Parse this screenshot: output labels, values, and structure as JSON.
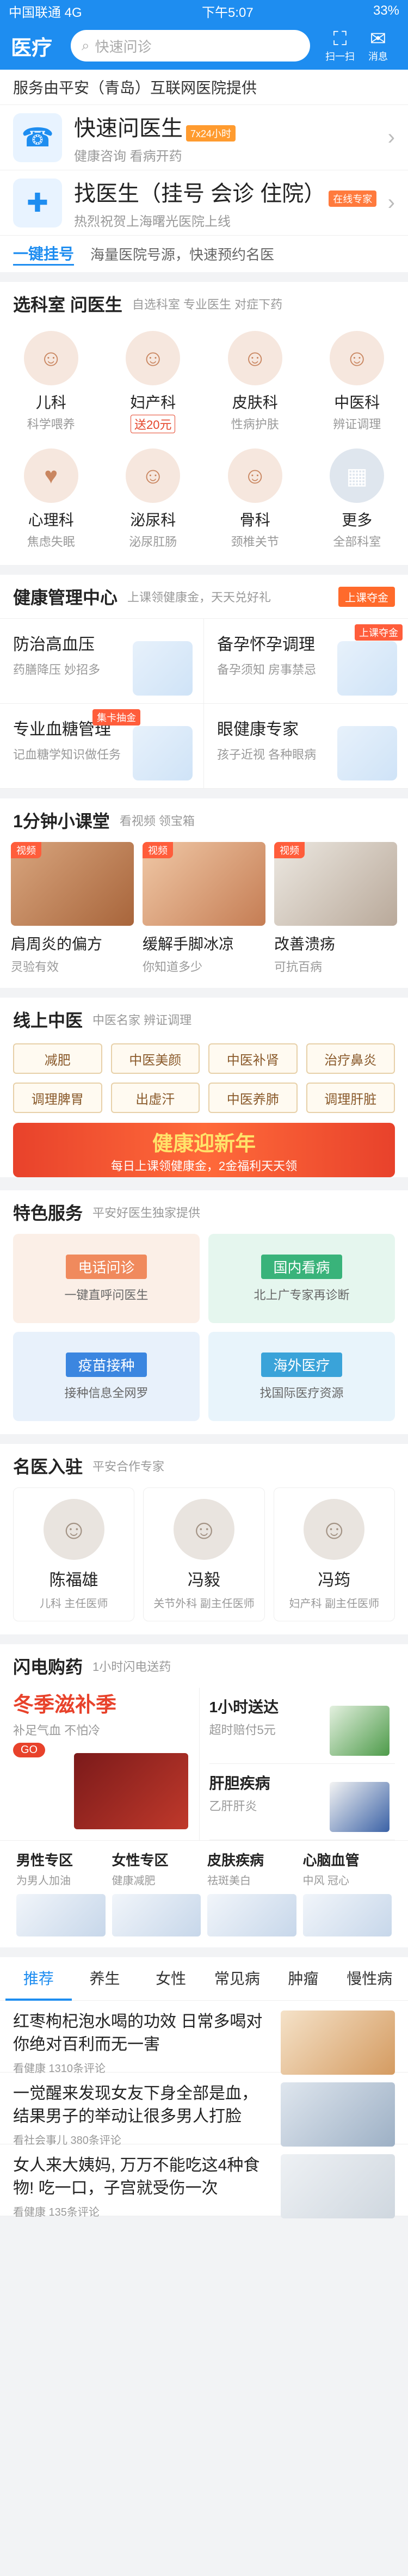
{
  "status": {
    "carrier": "中国联通 4G",
    "time": "下午5:07",
    "battery": "33%"
  },
  "top": {
    "brand": "医疗",
    "search_placeholder": "快速问诊",
    "scan": "扫一扫",
    "msg": "消息"
  },
  "provided": "服务由平安（青岛）互联网医院提供",
  "services": [
    {
      "title": "快速问医生",
      "tag": "7x24小时",
      "sub": "健康咨询 看病开药"
    },
    {
      "title": "找医生（挂号 会诊 住院）",
      "tag": "在线专家",
      "sub": "热烈祝贺上海曙光医院上线"
    }
  ],
  "quickreg": {
    "k": "一键挂号",
    "v": "海量医院号源，快速预约名医"
  },
  "depts": {
    "title": "选科室 问医生",
    "sub": "自选科室 专业医生 对症下药",
    "items": [
      {
        "nm": "儿科",
        "ds": "科学喂养"
      },
      {
        "nm": "妇产科",
        "ds": "送20元"
      },
      {
        "nm": "皮肤科",
        "ds": "性病护肤"
      },
      {
        "nm": "中医科",
        "ds": "辨证调理"
      },
      {
        "nm": "心理科",
        "ds": "焦虑失眠"
      },
      {
        "nm": "泌尿科",
        "ds": "泌尿肛肠"
      },
      {
        "nm": "骨科",
        "ds": "颈椎关节"
      },
      {
        "nm": "更多",
        "ds": "全部科室"
      }
    ]
  },
  "health": {
    "title": "健康管理中心",
    "sub": "上课领健康金，天天兑好礼",
    "badge": "上课夺金",
    "items": [
      {
        "t": "防治高血压",
        "s": "药膳降压 妙招多",
        "tag": ""
      },
      {
        "t": "备孕怀孕调理",
        "s": "备孕须知 房事禁忌",
        "tag": "上课夺金"
      },
      {
        "t": "专业血糖管理",
        "s": "记血糖学知识做任务",
        "tag": "集卡抽金"
      },
      {
        "t": "眼健康专家",
        "s": "孩子近视 各种眼病",
        "tag": ""
      }
    ]
  },
  "lessons": {
    "title": "1分钟小课堂",
    "sub": "看视频 领宝箱",
    "lbl": "视频",
    "items": [
      {
        "t": "肩周炎的偏方",
        "s": "灵验有效"
      },
      {
        "t": "缓解手脚冰凉",
        "s": "你知道多少"
      },
      {
        "t": "改善溃疡",
        "s": "可抗百病"
      }
    ]
  },
  "tcm": {
    "title": "线上中医",
    "sub": "中医名家 辨证调理",
    "items": [
      "减肥",
      "中医美颜",
      "中医补肾",
      "治疗鼻炎",
      "调理脾胃",
      "出虚汗",
      "中医养肺",
      "调理肝脏"
    ],
    "banner_a": "健康迎新年",
    "banner_b": "每日上课领健康金，2金福利天天领"
  },
  "feature": {
    "title": "特色服务",
    "sub": "平安好医生独家提供",
    "items": [
      {
        "t": "电话问诊",
        "s": "一键直呼问医生"
      },
      {
        "t": "国内看病",
        "s": "北上广专家再诊断"
      },
      {
        "t": "疫苗接种",
        "s": "接种信息全网罗"
      },
      {
        "t": "海外医疗",
        "s": "找国际医疗资源"
      }
    ]
  },
  "docs": {
    "title": "名医入驻",
    "sub": "平安合作专家",
    "items": [
      {
        "nm": "陈福雄",
        "ds": "儿科 主任医师"
      },
      {
        "nm": "冯毅",
        "ds": "关节外科 副主任医师"
      },
      {
        "nm": "冯筠",
        "ds": "妇产科 副主任医师"
      }
    ]
  },
  "shop": {
    "title": "闪电购药",
    "sub": "1小时闪电送药",
    "left_a": "冬季滋补季",
    "left_b": "补足气血 不怕冷",
    "go": "GO",
    "right": [
      {
        "t": "1小时送达",
        "s": "超时赔付5元"
      },
      {
        "t": "肝胆疾病",
        "s": "乙肝肝炎"
      }
    ],
    "four": [
      {
        "t": "男性专区",
        "s": "为男人加油"
      },
      {
        "t": "女性专区",
        "s": "健康减肥"
      },
      {
        "t": "皮肤疾病",
        "s": "祛斑美白"
      },
      {
        "t": "心脑血管",
        "s": "中风 冠心"
      }
    ]
  },
  "feed": {
    "tabs": [
      "推荐",
      "养生",
      "女性",
      "常见病",
      "肿瘤",
      "慢性病"
    ],
    "articles": [
      {
        "t": "红枣枸杞泡水喝的功效 日常多喝对你绝对百利而无一害",
        "s": "看健康 1310条评论"
      },
      {
        "t": "一觉醒来发现女友下身全部是血，结果男子的举动让很多男人打脸",
        "s": "看社会事儿 380条评论"
      },
      {
        "t": "女人来大姨妈, 万万不能吃这4种食物! 吃一口，子宫就受伤一次",
        "s": "看健康 135条评论"
      }
    ]
  },
  "icons": {
    "scan": "scan-icon",
    "msg": "message-icon",
    "search": "search-icon"
  },
  "colors": {
    "brand": "#1e8df0",
    "accent": "#ff5d3b"
  }
}
